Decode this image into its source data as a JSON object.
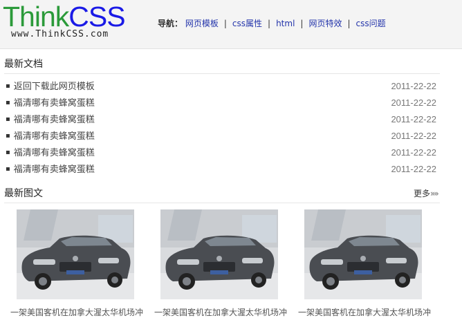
{
  "header": {
    "logo": {
      "think": "Think",
      "css": "CSS",
      "url": "www.ThinkCSS.com"
    },
    "nav": {
      "label": "导航：",
      "items": [
        "网页模板",
        "css属性",
        "html",
        "网页特效",
        "css问题"
      ],
      "separator": "|"
    }
  },
  "latest_docs": {
    "title": "最新文档",
    "bullet": "▪",
    "items": [
      {
        "title": "返回下载此网页模板",
        "date": "2011-22-22"
      },
      {
        "title": "福清哪有卖蜂窝蛋糕",
        "date": "2011-22-22"
      },
      {
        "title": "福清哪有卖蜂窝蛋糕",
        "date": "2011-22-22"
      },
      {
        "title": "福清哪有卖蜂窝蛋糕",
        "date": "2011-22-22"
      },
      {
        "title": "福清哪有卖蜂窝蛋糕",
        "date": "2011-22-22"
      },
      {
        "title": "福清哪有卖蜂窝蛋糕",
        "date": "2011-22-22"
      }
    ]
  },
  "latest_photos": {
    "title": "最新图文",
    "more": "更多",
    "more_arrows": "»»",
    "items": [
      {
        "caption": "一架美国客机在加拿大渥太华机场冲"
      },
      {
        "caption": "一架美国客机在加拿大渥太华机场冲"
      },
      {
        "caption": "一架美国客机在加拿大渥太华机场冲"
      }
    ]
  },
  "colors": {
    "logo_green": "#2b9a3a",
    "logo_blue": "#1a1ae6",
    "nav_link": "#2233aa",
    "header_bg": "#f4f4f4"
  }
}
